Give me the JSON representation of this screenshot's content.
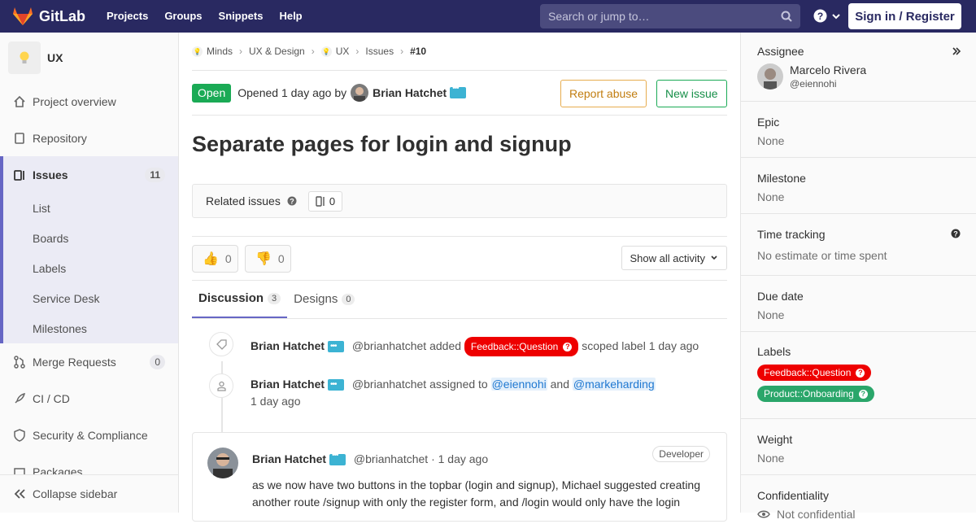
{
  "topbar": {
    "brand": "GitLab",
    "nav": [
      "Projects",
      "Groups",
      "Snippets",
      "Help"
    ],
    "search_placeholder": "Search or jump to…",
    "signin": "Sign in / Register"
  },
  "sidebar": {
    "project": "UX",
    "items": [
      {
        "label": "Project overview"
      },
      {
        "label": "Repository"
      },
      {
        "label": "Issues",
        "badge": "11"
      },
      {
        "label": "Merge Requests",
        "badge": "0"
      },
      {
        "label": "CI / CD"
      },
      {
        "label": "Security & Compliance"
      },
      {
        "label": "Packages"
      }
    ],
    "issue_sub": [
      "List",
      "Boards",
      "Labels",
      "Service Desk",
      "Milestones"
    ],
    "collapse": "Collapse sidebar"
  },
  "breadcrumb": [
    "Minds",
    "UX & Design",
    "UX",
    "Issues",
    "#10"
  ],
  "issue": {
    "status": "Open",
    "opened": "Opened 1 day ago by",
    "author": "Brian Hatchet",
    "report": "Report abuse",
    "new": "New issue",
    "title": "Separate pages for login and signup",
    "related_label": "Related issues",
    "related_count": "0",
    "thumbs_up": "0",
    "thumbs_down": "0",
    "show_activity": "Show all activity",
    "tabs": [
      {
        "label": "Discussion",
        "count": "3"
      },
      {
        "label": "Designs",
        "count": "0"
      }
    ]
  },
  "timeline": {
    "note1": {
      "author": "Brian Hatchet",
      "handle": "@brianhatchet",
      "action": "added",
      "label": "Feedback::Question",
      "suffix": "scoped label 1 day ago"
    },
    "note2": {
      "author": "Brian Hatchet",
      "handle": "@brianhatchet",
      "action": "assigned to",
      "m1": "@eiennohi",
      "and": "and",
      "m2": "@markeharding",
      "time": "1 day ago"
    },
    "comment": {
      "author": "Brian Hatchet",
      "handle": "@brianhatchet · 1 day ago",
      "role": "Developer",
      "body": "as we now have two buttons in the topbar (login and signup), Michael suggested creating another route /signup with only the register form, and /login would only have the login"
    }
  },
  "right": {
    "assignee_label": "Assignee",
    "assignee_name": "Marcelo Rivera",
    "assignee_handle": "@eiennohi",
    "epic_label": "Epic",
    "epic": "None",
    "milestone_label": "Milestone",
    "milestone": "None",
    "time_label": "Time tracking",
    "time": "No estimate or time spent",
    "due_label": "Due date",
    "due": "None",
    "labels_label": "Labels",
    "labels": [
      "Feedback::Question",
      "Product::Onboarding"
    ],
    "weight_label": "Weight",
    "weight": "None",
    "conf_label": "Confidentiality",
    "conf": "Not confidential"
  },
  "colors": {
    "topbar": "#292961",
    "accent": "#6666c4",
    "open": "#1aaa55",
    "label_red": "#ee0000",
    "label_green": "#2aa66a"
  }
}
